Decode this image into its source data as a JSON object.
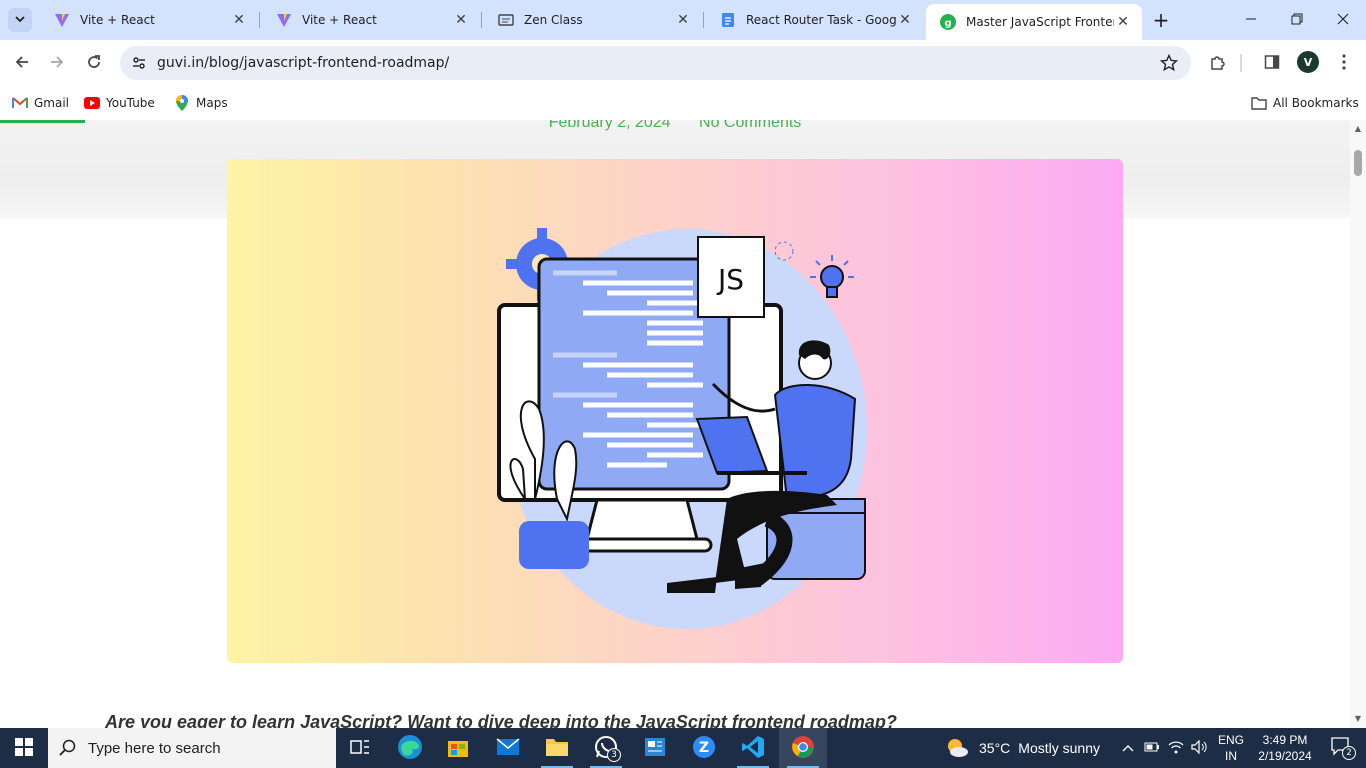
{
  "browser": {
    "tabs": [
      {
        "title": "Vite + React",
        "icon": "vite-icon",
        "active": false
      },
      {
        "title": "Vite + React",
        "icon": "vite-icon",
        "active": false
      },
      {
        "title": "Zen Class",
        "icon": "zen-class-icon",
        "active": false
      },
      {
        "title": "React Router Task - Google Docs",
        "icon": "google-docs-icon",
        "active": false
      },
      {
        "title": "Master JavaScript Frontend Roadmap",
        "icon": "guvi-icon",
        "active": true
      }
    ],
    "url": "guvi.in/blog/javascript-frontend-roadmap/",
    "profile_initial": "V",
    "bookmarks": [
      {
        "label": "Gmail",
        "icon": "gmail-icon"
      },
      {
        "label": "YouTube",
        "icon": "youtube-icon"
      },
      {
        "label": "Maps",
        "icon": "maps-icon"
      }
    ],
    "all_bookmarks_label": "All Bookmarks"
  },
  "page": {
    "post_date": "February 2, 2024",
    "comments": "No Comments",
    "hero_badge": "JS",
    "intro": "Are you eager to learn JavaScript? Want to dive deep into the JavaScript frontend roadmap?",
    "accent_color": "#4caf50"
  },
  "taskbar": {
    "search_placeholder": "Type here to search",
    "whatsapp_badge": "3",
    "weather_temp": "35°C",
    "weather_desc": "Mostly sunny",
    "lang_line1": "ENG",
    "lang_line2": "IN",
    "time": "3:49 PM",
    "date": "2/19/2024",
    "notification_count": "2"
  }
}
